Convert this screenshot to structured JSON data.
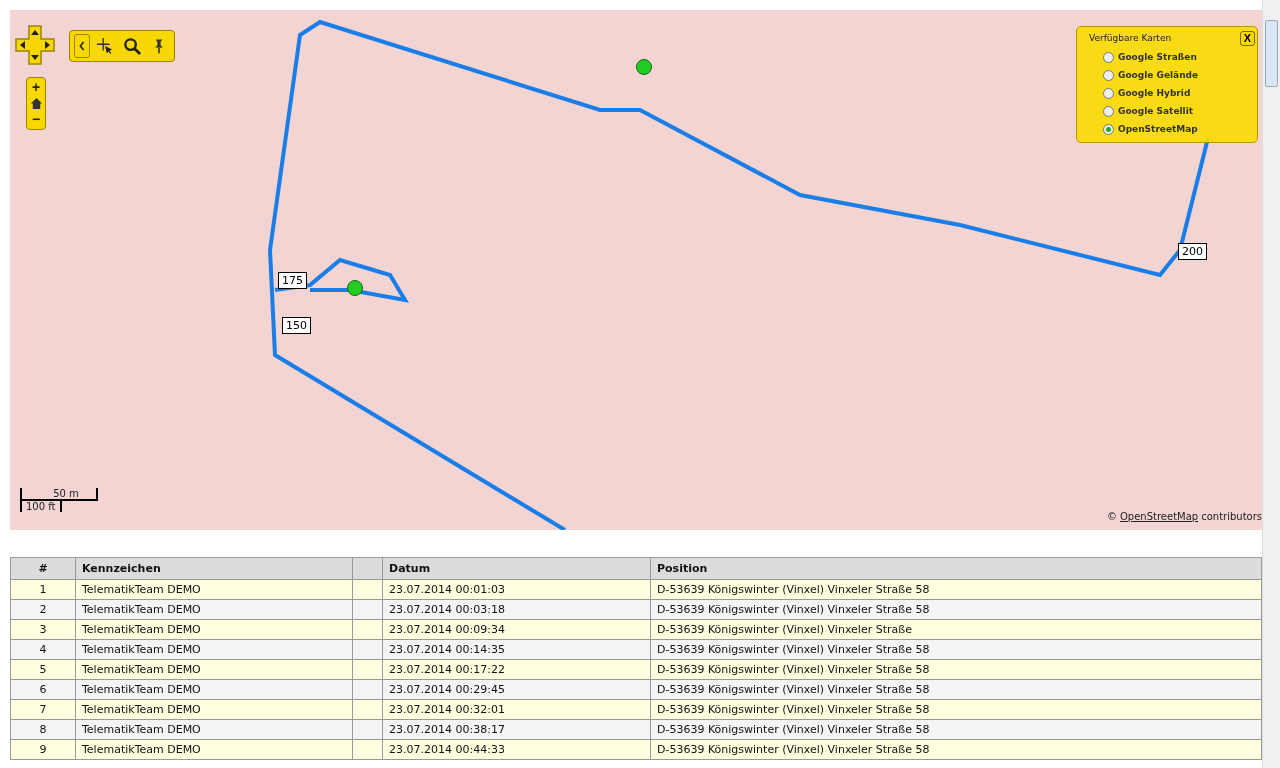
{
  "map": {
    "zoom_in": "+",
    "zoom_out": "−",
    "route_labels": [
      "175",
      "150",
      "200"
    ],
    "scale": {
      "metric": "50 m",
      "imperial": "100 ft"
    },
    "attribution": {
      "prefix": "©",
      "link": "OpenStreetMap",
      "suffix": "contributors"
    },
    "layer_switcher": {
      "title": "Verfügbare Karten",
      "close": "X",
      "layers": [
        {
          "label": "Google Straßen",
          "selected": false
        },
        {
          "label": "Google Gelände",
          "selected": false
        },
        {
          "label": "Google Hybrid",
          "selected": false
        },
        {
          "label": "Google Satellit",
          "selected": false
        },
        {
          "label": "OpenStreetMap",
          "selected": true
        }
      ]
    }
  },
  "table": {
    "columns": [
      "#",
      "Kennzeichen",
      "Datum",
      "Position"
    ],
    "rows": [
      {
        "number": "1",
        "plate": "TelematikTeam DEMO",
        "date": "23.07.2014 00:01:03",
        "position": "D-53639 Königswinter (Vinxel) Vinxeler Straße 58"
      },
      {
        "number": "2",
        "plate": "TelematikTeam DEMO",
        "date": "23.07.2014 00:03:18",
        "position": "D-53639 Königswinter (Vinxel) Vinxeler Straße 58"
      },
      {
        "number": "3",
        "plate": "TelematikTeam DEMO",
        "date": "23.07.2014 00:09:34",
        "position": "D-53639 Königswinter (Vinxel) Vinxeler Straße"
      },
      {
        "number": "4",
        "plate": "TelematikTeam DEMO",
        "date": "23.07.2014 00:14:35",
        "position": "D-53639 Königswinter (Vinxel) Vinxeler Straße 58"
      },
      {
        "number": "5",
        "plate": "TelematikTeam DEMO",
        "date": "23.07.2014 00:17:22",
        "position": "D-53639 Königswinter (Vinxel) Vinxeler Straße 58"
      },
      {
        "number": "6",
        "plate": "TelematikTeam DEMO",
        "date": "23.07.2014 00:29:45",
        "position": "D-53639 Königswinter (Vinxel) Vinxeler Straße 58"
      },
      {
        "number": "7",
        "plate": "TelematikTeam DEMO",
        "date": "23.07.2014 00:32:01",
        "position": "D-53639 Königswinter (Vinxel) Vinxeler Straße 58"
      },
      {
        "number": "8",
        "plate": "TelematikTeam DEMO",
        "date": "23.07.2014 00:38:17",
        "position": "D-53639 Königswinter (Vinxel) Vinxeler Straße 58"
      },
      {
        "number": "9",
        "plate": "TelematikTeam DEMO",
        "date": "23.07.2014 00:44:33",
        "position": "D-53639 Königswinter (Vinxel) Vinxeler Straße 58"
      }
    ]
  }
}
